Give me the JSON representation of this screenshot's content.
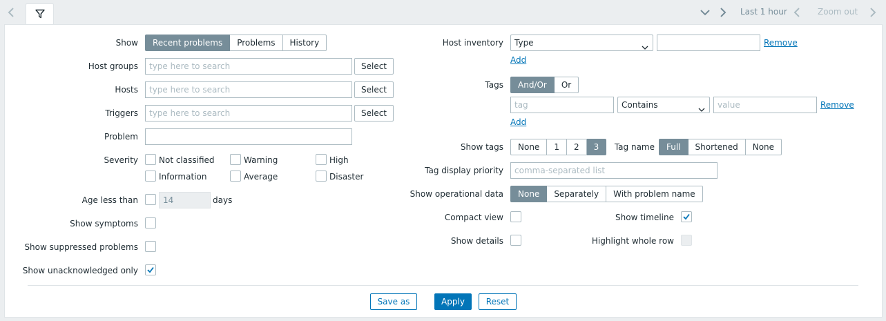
{
  "topbar": {
    "time_range": "Last 1 hour",
    "zoom_out": "Zoom out",
    "icons": [
      "chevron-left-icon",
      "filter-icon",
      "chevron-down-icon",
      "chevron-right-icon",
      "chevron-left-icon",
      "chevron-right-icon"
    ]
  },
  "left": {
    "show": {
      "label": "Show",
      "options": [
        "Recent problems",
        "Problems",
        "History"
      ],
      "selected": "Recent problems"
    },
    "host_groups": {
      "label": "Host groups",
      "placeholder": "type here to search",
      "button": "Select"
    },
    "hosts": {
      "label": "Hosts",
      "placeholder": "type here to search",
      "button": "Select"
    },
    "triggers": {
      "label": "Triggers",
      "placeholder": "type here to search",
      "button": "Select"
    },
    "problem": {
      "label": "Problem",
      "value": ""
    },
    "severity": {
      "label": "Severity",
      "options": [
        "Not classified",
        "Warning",
        "High",
        "Information",
        "Average",
        "Disaster"
      ],
      "checked": []
    },
    "age": {
      "label": "Age less than",
      "value": "14",
      "unit": "days",
      "checked": false
    },
    "show_symptoms": {
      "label": "Show symptoms",
      "checked": false
    },
    "show_suppressed": {
      "label": "Show suppressed problems",
      "checked": false
    },
    "show_unack": {
      "label": "Show unacknowledged only",
      "checked": true
    }
  },
  "right": {
    "host_inventory": {
      "label": "Host inventory",
      "field": "Type",
      "value": "",
      "remove": "Remove",
      "add": "Add"
    },
    "tags": {
      "label": "Tags",
      "operator_options": [
        "And/Or",
        "Or"
      ],
      "operator_selected": "And/Or",
      "tag_placeholder": "tag",
      "condition": "Contains",
      "value_placeholder": "value",
      "remove": "Remove",
      "add": "Add"
    },
    "show_tags": {
      "label": "Show tags",
      "options": [
        "None",
        "1",
        "2",
        "3"
      ],
      "selected": "3"
    },
    "tag_name": {
      "label": "Tag name",
      "options": [
        "Full",
        "Shortened",
        "None"
      ],
      "selected": "Full"
    },
    "tag_priority": {
      "label": "Tag display priority",
      "placeholder": "comma-separated list"
    },
    "operational_data": {
      "label": "Show operational data",
      "options": [
        "None",
        "Separately",
        "With problem name"
      ],
      "selected": "None"
    },
    "compact_view": {
      "label": "Compact view",
      "checked": false
    },
    "show_timeline": {
      "label": "Show timeline",
      "checked": true
    },
    "show_details": {
      "label": "Show details",
      "checked": false
    },
    "highlight_row": {
      "label": "Highlight whole row",
      "checked": false,
      "disabled": true
    }
  },
  "actions": {
    "save_as": "Save as",
    "apply": "Apply",
    "reset": "Reset"
  }
}
